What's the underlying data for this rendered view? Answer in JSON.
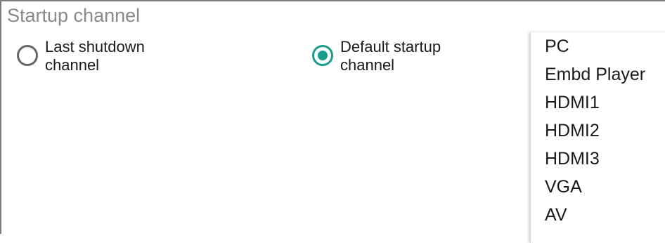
{
  "section": {
    "title": "Startup channel"
  },
  "radio_options": [
    {
      "label": "Last shutdown channel",
      "checked": false
    },
    {
      "label": "Default startup channel",
      "checked": true
    }
  ],
  "dropdown": {
    "items": [
      "PC",
      "Embd Player",
      "HDMI1",
      "HDMI2",
      "HDMI3",
      "VGA",
      "AV"
    ]
  },
  "colors": {
    "accent": "#1a9e8c",
    "title_gray": "#8a8a8a",
    "text": "#1a1a1a"
  }
}
